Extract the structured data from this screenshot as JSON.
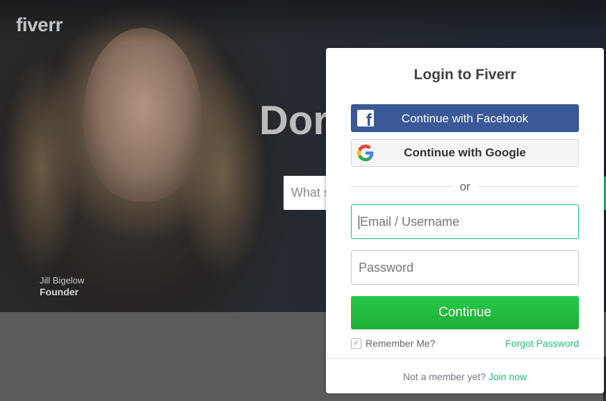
{
  "hero": {
    "logo": "fiverr",
    "headline_partial": "Dor",
    "search_placeholder_partial": "What s",
    "caption_name": "Jill Bigelow",
    "caption_role": "Founder"
  },
  "modal": {
    "title": "Login to Fiverr",
    "facebook_button": "Continue with Facebook",
    "google_button": "Continue with Google",
    "divider_text": "or",
    "email_placeholder": "Email / Username",
    "password_placeholder": "Password",
    "continue_button": "Continue",
    "remember_me_label": "Remember Me?",
    "remember_me_checked": true,
    "forgot_password_link": "Forgot Password",
    "footer_prompt": "Not a member yet?",
    "join_link": "Join now"
  },
  "colors": {
    "brand_green": "#1dbf73",
    "facebook_blue": "#3b5998"
  }
}
